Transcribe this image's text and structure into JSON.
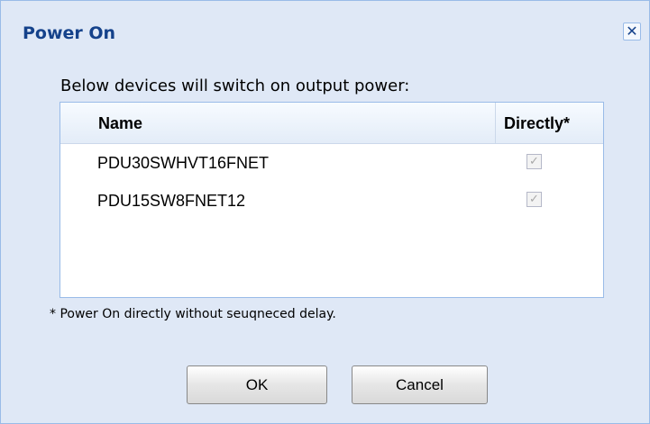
{
  "dialog": {
    "title": "Power On",
    "close_icon": "close-icon",
    "description": "Below devices will switch on output power:",
    "columns": {
      "name": "Name",
      "directly": "Directly*"
    },
    "rows": [
      {
        "name": "PDU30SWHVT16FNET",
        "directly": true
      },
      {
        "name": "PDU15SW8FNET12",
        "directly": true
      }
    ],
    "footnote": "* Power On directly without seuqneced delay.",
    "buttons": {
      "ok": "OK",
      "cancel": "Cancel"
    },
    "colors": {
      "background": "#dfe8f6",
      "title": "#15428b",
      "border": "#99bbe8"
    }
  }
}
